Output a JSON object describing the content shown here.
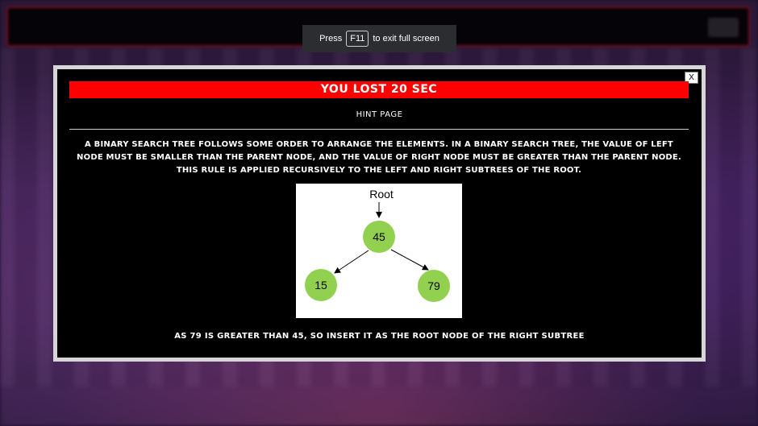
{
  "toast": {
    "press": "Press",
    "key": "F11",
    "suffix": "to exit full screen"
  },
  "modal": {
    "close_label": "X",
    "banner": "YOU LOST 20 SEC",
    "hint_title": "HINT PAGE",
    "hint_text": "A BINARY SEARCH TREE FOLLOWS SOME ORDER TO ARRANGE THE ELEMENTS. IN A BINARY SEARCH TREE, THE VALUE OF LEFT NODE MUST BE SMALLER THAN THE PARENT NODE, AND THE VALUE OF RIGHT NODE MUST BE GREATER THAN THE PARENT NODE. THIS RULE IS APPLIED RECURSIVELY TO THE LEFT AND RIGHT SUBTREES OF THE ROOT.",
    "diagram": {
      "root_label": "Root",
      "root_value": "45",
      "left_value": "15",
      "right_value": "79",
      "node_color": "#92d050"
    },
    "conclusion": "AS 79 IS GREATER THAN 45, SO INSERT IT AS THE ROOT NODE OF THE RIGHT SUBTREE"
  },
  "colors": {
    "banner": "#ff0000",
    "modal_border": "#d6d6d6",
    "node": "#92d050"
  }
}
